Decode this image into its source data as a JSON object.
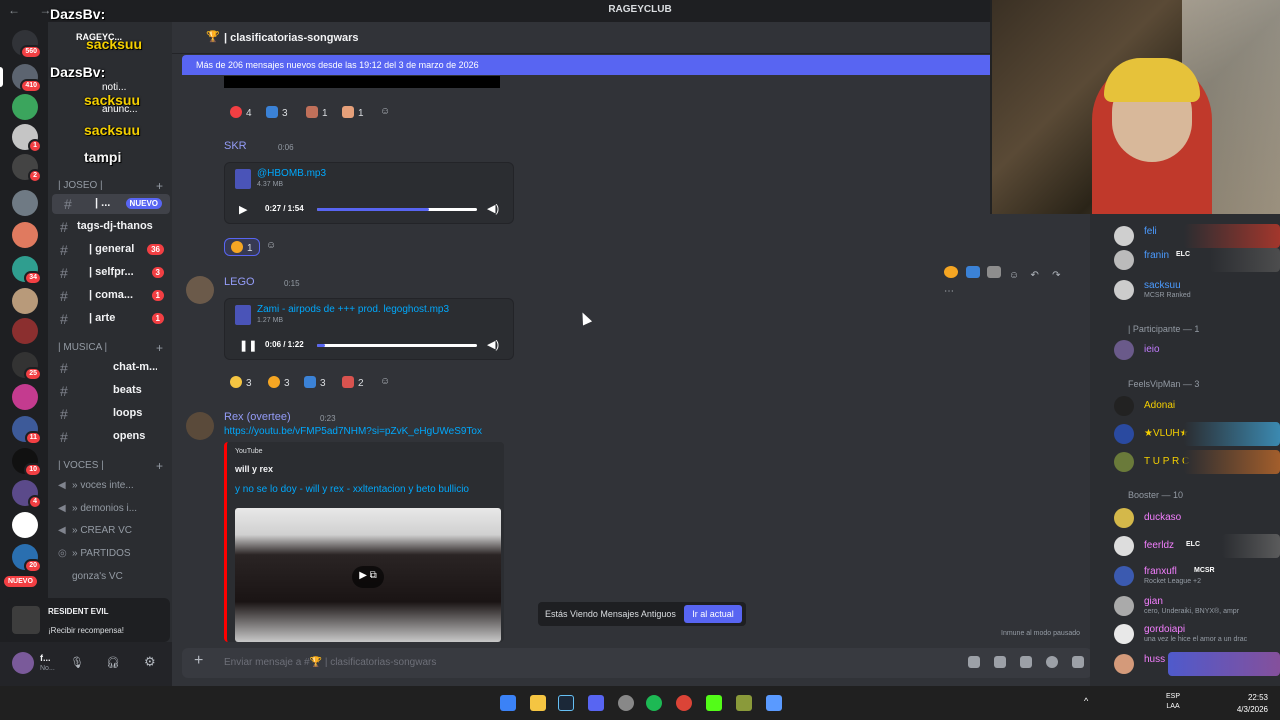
{
  "titlebar": {
    "server": "RAGEYCLUB",
    "nav": "← →"
  },
  "overlay": {
    "name1": "DazsBv:",
    "name2": "sacksuu",
    "name3": "DazsBv:",
    "name4": "sacksuu",
    "name5": "sacksuu",
    "name6": "tampi",
    "srvname": "RAGEYC...",
    "noti": "noti...",
    "anunc": "anunc..."
  },
  "rail_badges": [
    "560",
    "410",
    "1",
    "2",
    "34",
    "25",
    "11",
    "10",
    "4",
    "20"
  ],
  "rail_nuevo": "NUEVO",
  "sidebar": {
    "cat_joseo": "| JOSEO |",
    "channels": [
      {
        "name": "| ...",
        "badge": "NUEVO"
      },
      {
        "name": "tags-dj-thanos",
        "badge": ""
      },
      {
        "name": "| general",
        "badge": "36"
      },
      {
        "name": "| selfpr...",
        "badge": "3"
      },
      {
        "name": "| coma...",
        "badge": "1"
      },
      {
        "name": "| arte",
        "badge": "1"
      }
    ],
    "cat_musica": "| MUSICA |",
    "music": [
      {
        "name": "chat-m..."
      },
      {
        "name": "beats"
      },
      {
        "name": "loops"
      },
      {
        "name": "opens"
      }
    ],
    "cat_voces": "| VOCES |",
    "voice": [
      "» voces inte...",
      "» demonios i...",
      "» CREAR VC",
      "» PARTIDOS",
      "gonza's VC"
    ]
  },
  "promo": {
    "title": "RESIDENT EVIL",
    "cta": "¡Recibir recompensa!"
  },
  "user": {
    "name": "f...",
    "status": "No..."
  },
  "chat": {
    "channel": "| clasificatorias-songwars",
    "new_banner": "Más de 206 mensajes nuevos desde las 19:12 del 3 de marzo de 2026",
    "reacts_top": [
      {
        "n": "4"
      },
      {
        "n": "3"
      },
      {
        "n": "1"
      },
      {
        "n": "1"
      }
    ],
    "msg1": {
      "name": "SKR",
      "time": "0:06",
      "file": "@HBOMB.mp3",
      "size": "4.37 MB",
      "pos": "0:27 / 1:54",
      "progress": 0.7,
      "react": "1"
    },
    "msg2": {
      "name": "LEGO",
      "time": "0:15",
      "file": "Zami - airpods de +++ prod. legoghost.mp3",
      "size": "1.27 MB",
      "pos": "0:06 / 1:22",
      "progress": 0.05,
      "reacts": [
        "3",
        "3",
        "3",
        "2"
      ]
    },
    "msg3": {
      "name": "Rex (overtee)",
      "time": "0:23",
      "link": "https://youtu.be/vFMP5ad7NHM?si=pZvK_eHgUWeS9Tox",
      "provider": "YouTube",
      "author": "will y rex",
      "title": "y no se lo doy - will y rex - xxltentacion y beto bullicio"
    },
    "old_label": "Estás Viendo Mensajes Antiguos",
    "old_button": "Ir al actual",
    "immune": "Inmune al modo pausado",
    "placeholder": "Enviar mensaje a #🏆 | clasificatorias-songwars"
  },
  "members": {
    "list": [
      {
        "name": "feli",
        "color": "#4b9bff",
        "sub": ""
      },
      {
        "name": "franin",
        "color": "#4b9bff",
        "sub": "",
        "tag": "ELC"
      },
      {
        "name": "sacksuu",
        "color": "#4b9bff",
        "sub": "MCSR Ranked"
      }
    ],
    "cat_part": "| Participante — 1",
    "part": [
      {
        "name": "ieio",
        "color": "#c27cff"
      }
    ],
    "cat_vip": "FeelsVipMan — 3",
    "vip": [
      {
        "name": "Adonai",
        "color": "#f5d000"
      },
      {
        "name": "★VLUH★",
        "color": "#f5d000"
      },
      {
        "name": "T U P R C",
        "color": "#f5d000"
      }
    ],
    "cat_boost": "Booster — 10",
    "boost": [
      {
        "name": "duckaso",
        "color": "#f47fff",
        "sub": ""
      },
      {
        "name": "feerldz",
        "color": "#f47fff",
        "sub": "",
        "tag": "ELC"
      },
      {
        "name": "franxufl",
        "color": "#f47fff",
        "sub": "Rocket League +2",
        "tag": "MCSR"
      },
      {
        "name": "gian",
        "color": "#f47fff",
        "sub": "cero, Underaiki, BNYX®, ampr"
      },
      {
        "name": "gordoiapi",
        "color": "#f47fff",
        "sub": "una vez le hice el amor a un drac"
      },
      {
        "name": "huss",
        "color": "#f47fff",
        "sub": ""
      }
    ]
  },
  "taskbar": {
    "lang1": "ESP",
    "lang2": "LAA",
    "time": "22:53",
    "date": "4/3/2026"
  }
}
